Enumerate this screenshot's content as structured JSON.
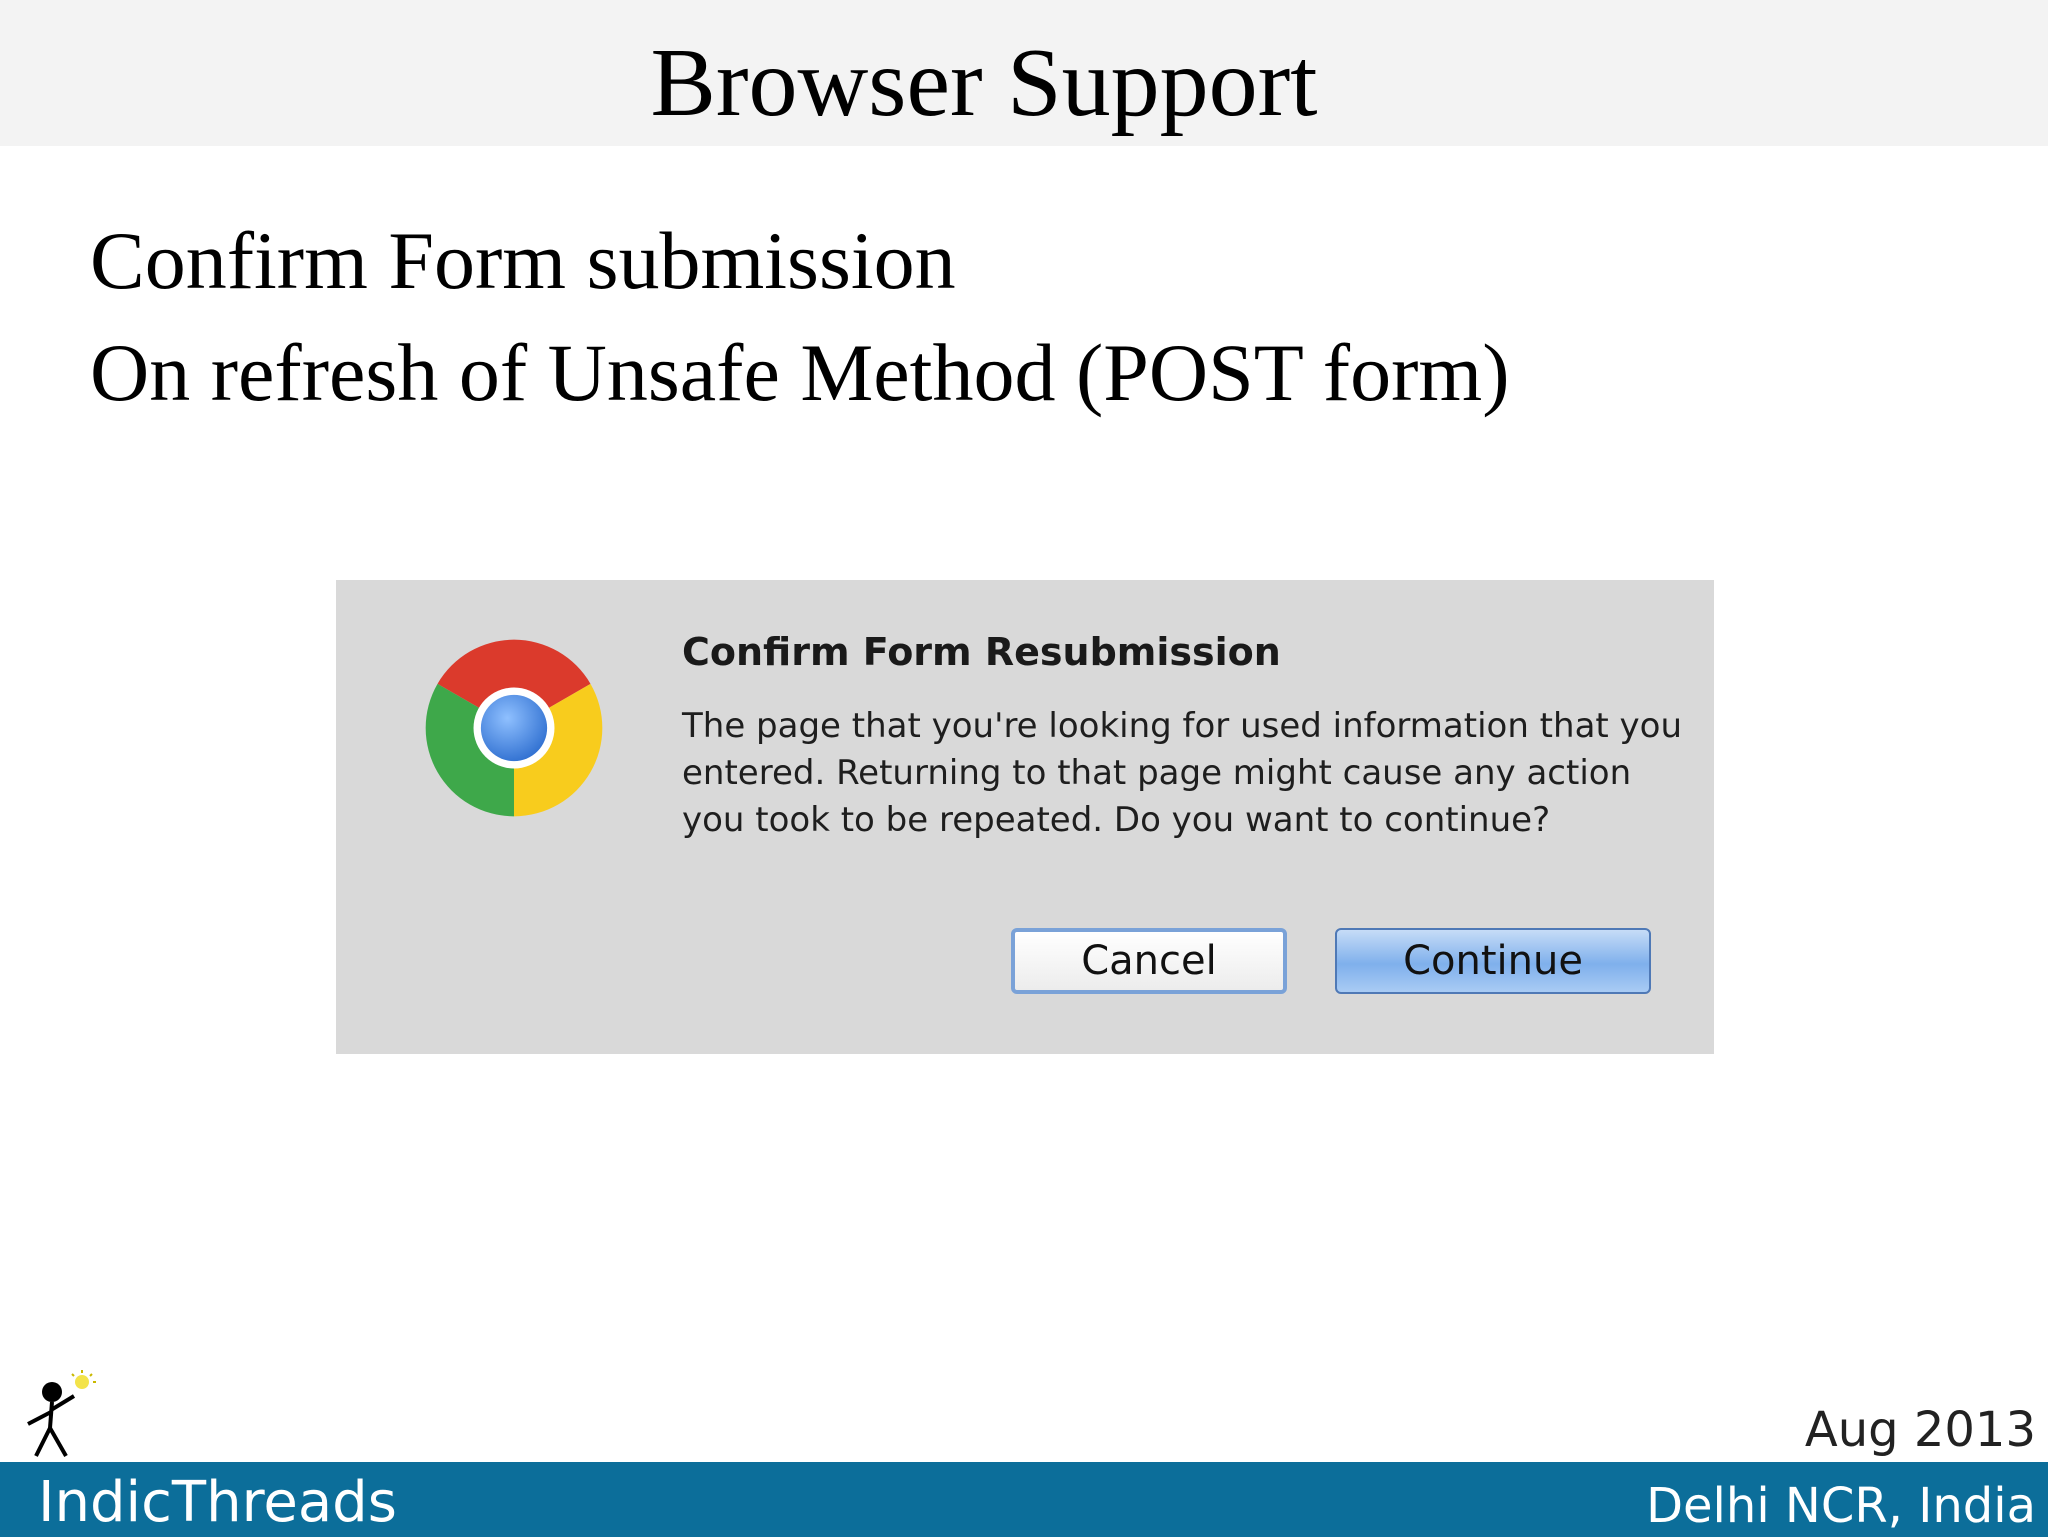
{
  "slide": {
    "title": "Browser Support",
    "bullets": [
      "Confirm Form submission",
      "On refresh of Unsafe Method (POST form)"
    ]
  },
  "dialog": {
    "icon": "chrome-logo-icon",
    "title": "Confirm Form Resubmission",
    "message": "The page that you're looking for used information that you entered. Returning to that page might cause any action you took to be repeated. Do you want to continue?",
    "cancel_label": "Cancel",
    "continue_label": "Continue"
  },
  "footer": {
    "brand": "IndicThreads",
    "date": "Aug 2013",
    "location": "Delhi NCR, India",
    "logo_icon": "stick-figure-lightbulb-icon"
  },
  "colors": {
    "title_band": "#f3f3f3",
    "footer_band": "#0c6e9a",
    "dialog_bg": "#d9d9d9",
    "continue_button": "#7fb0ec"
  }
}
